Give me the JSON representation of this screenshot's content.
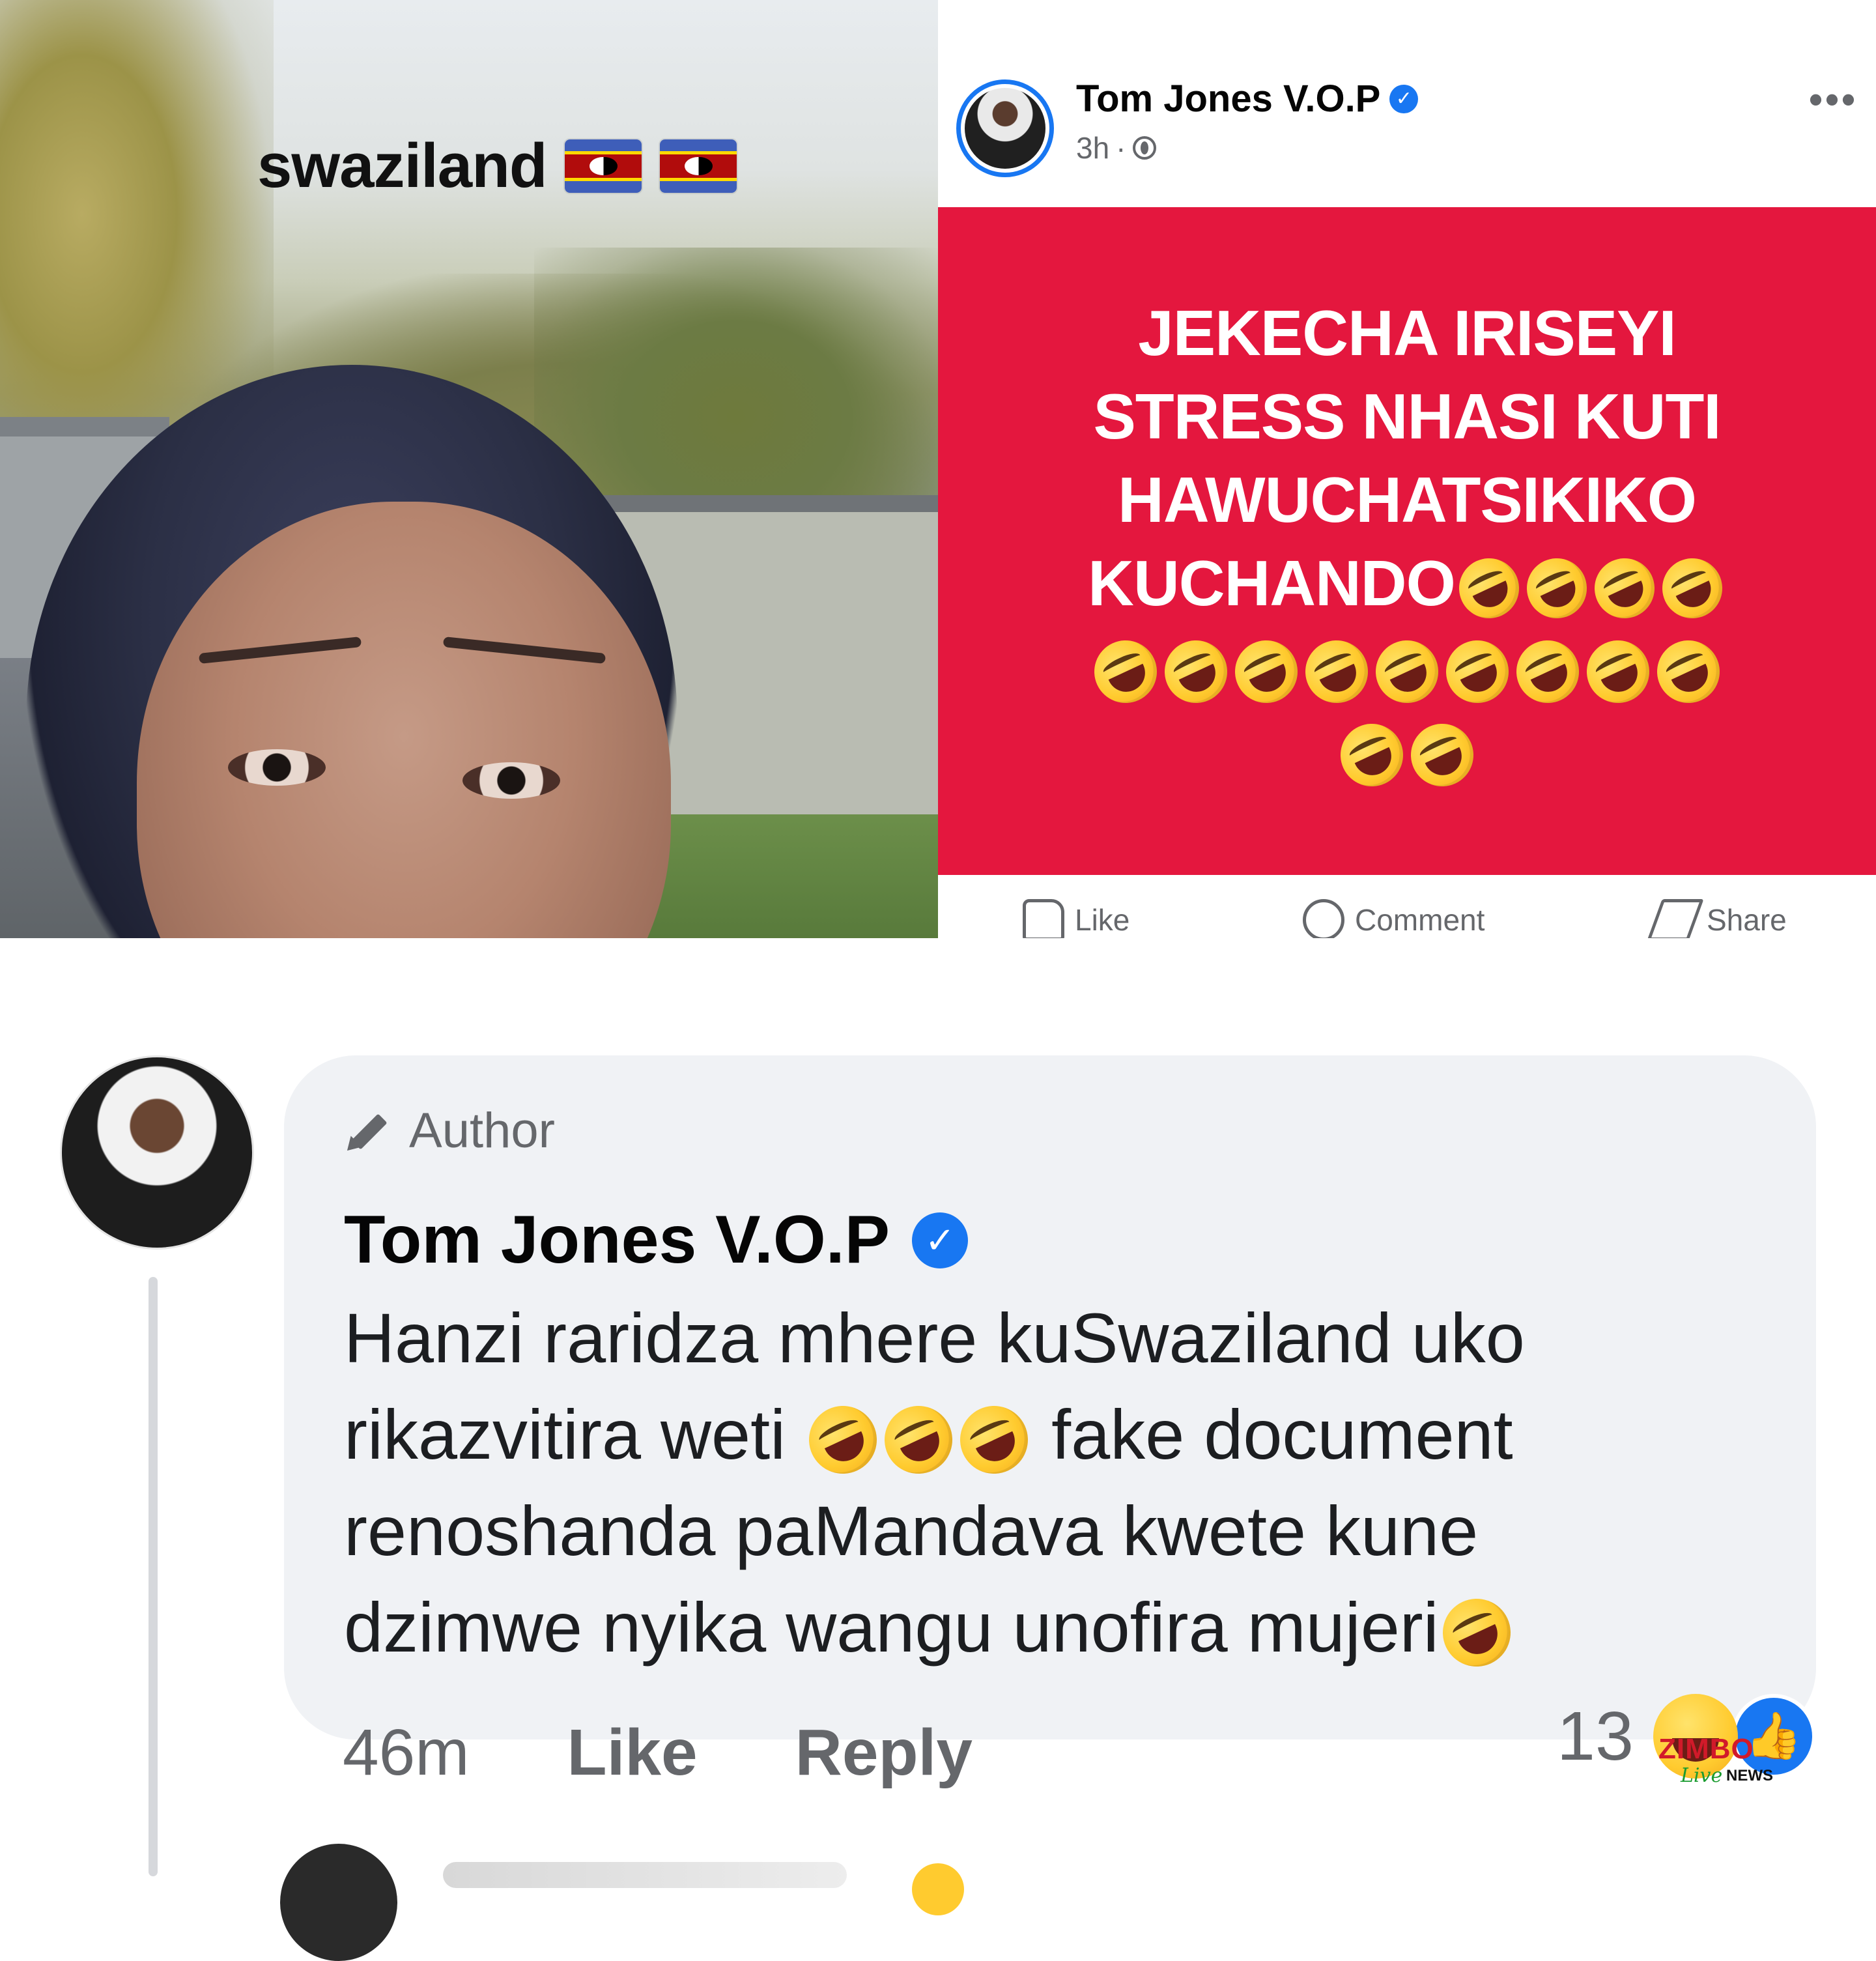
{
  "photo": {
    "caption": "swaziland",
    "flag_icon": "eswatini-flag-icon"
  },
  "post": {
    "author_name": "Tom Jones V.O.P",
    "verified_icon": "verified-badge-icon",
    "time": "3h",
    "separator": "·",
    "privacy_icon": "globe-icon",
    "more_label": "•••",
    "card_color": "#e4173e",
    "card_lines": [
      "JEKECHA IRISEYI",
      "STRESS NHASI KUTI",
      "HAWUCHATSIKIKO",
      "KUCHANDO"
    ],
    "card_emoji": "rolling-on-floor-laughing-emoji",
    "actions": {
      "like": "Like",
      "comment": "Comment",
      "share": "Share"
    }
  },
  "comment": {
    "author_label": "Author",
    "name": "Tom Jones V.O.P",
    "text_lines": [
      "Hanzi raridza mhere kuSwaziland uko",
      "rikazvitira weti",
      "fake document",
      "renoshanda paMandava kwete kune",
      "dzimwe nyika wangu unofira mujeri"
    ],
    "time": "46m",
    "like_label": "Like",
    "reply_label": "Reply",
    "reaction_count": "13",
    "reactions": [
      "haha-reaction-icon",
      "like-reaction-icon"
    ]
  },
  "watermark": {
    "brand": "ZIMBO",
    "live": "Live",
    "news": "NEWS"
  },
  "colors": {
    "facebook_blue": "#1877f2",
    "secondary_text": "#65676b",
    "bubble": "#f0f2f5"
  }
}
